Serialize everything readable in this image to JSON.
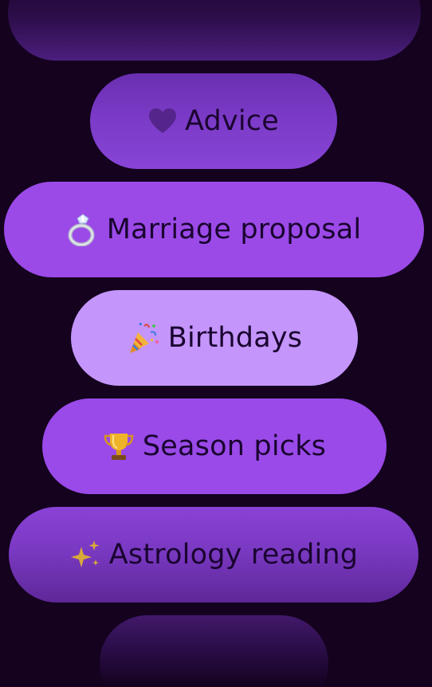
{
  "options": [
    {
      "label": "",
      "icon": ""
    },
    {
      "label": "Advice",
      "icon": "purple-heart-icon"
    },
    {
      "label": "Marriage proposal",
      "icon": "ring-icon"
    },
    {
      "label": "Birthdays",
      "icon": "party-popper-icon",
      "selected": true
    },
    {
      "label": "Season picks",
      "icon": "trophy-icon"
    },
    {
      "label": "Astrology reading",
      "icon": "sparkles-icon"
    },
    {
      "label": "",
      "icon": ""
    }
  ],
  "colors": {
    "background": "#14021f",
    "pill": "#9b4ae8",
    "selected_pill": "#c495fb",
    "text": "#1a0430"
  }
}
